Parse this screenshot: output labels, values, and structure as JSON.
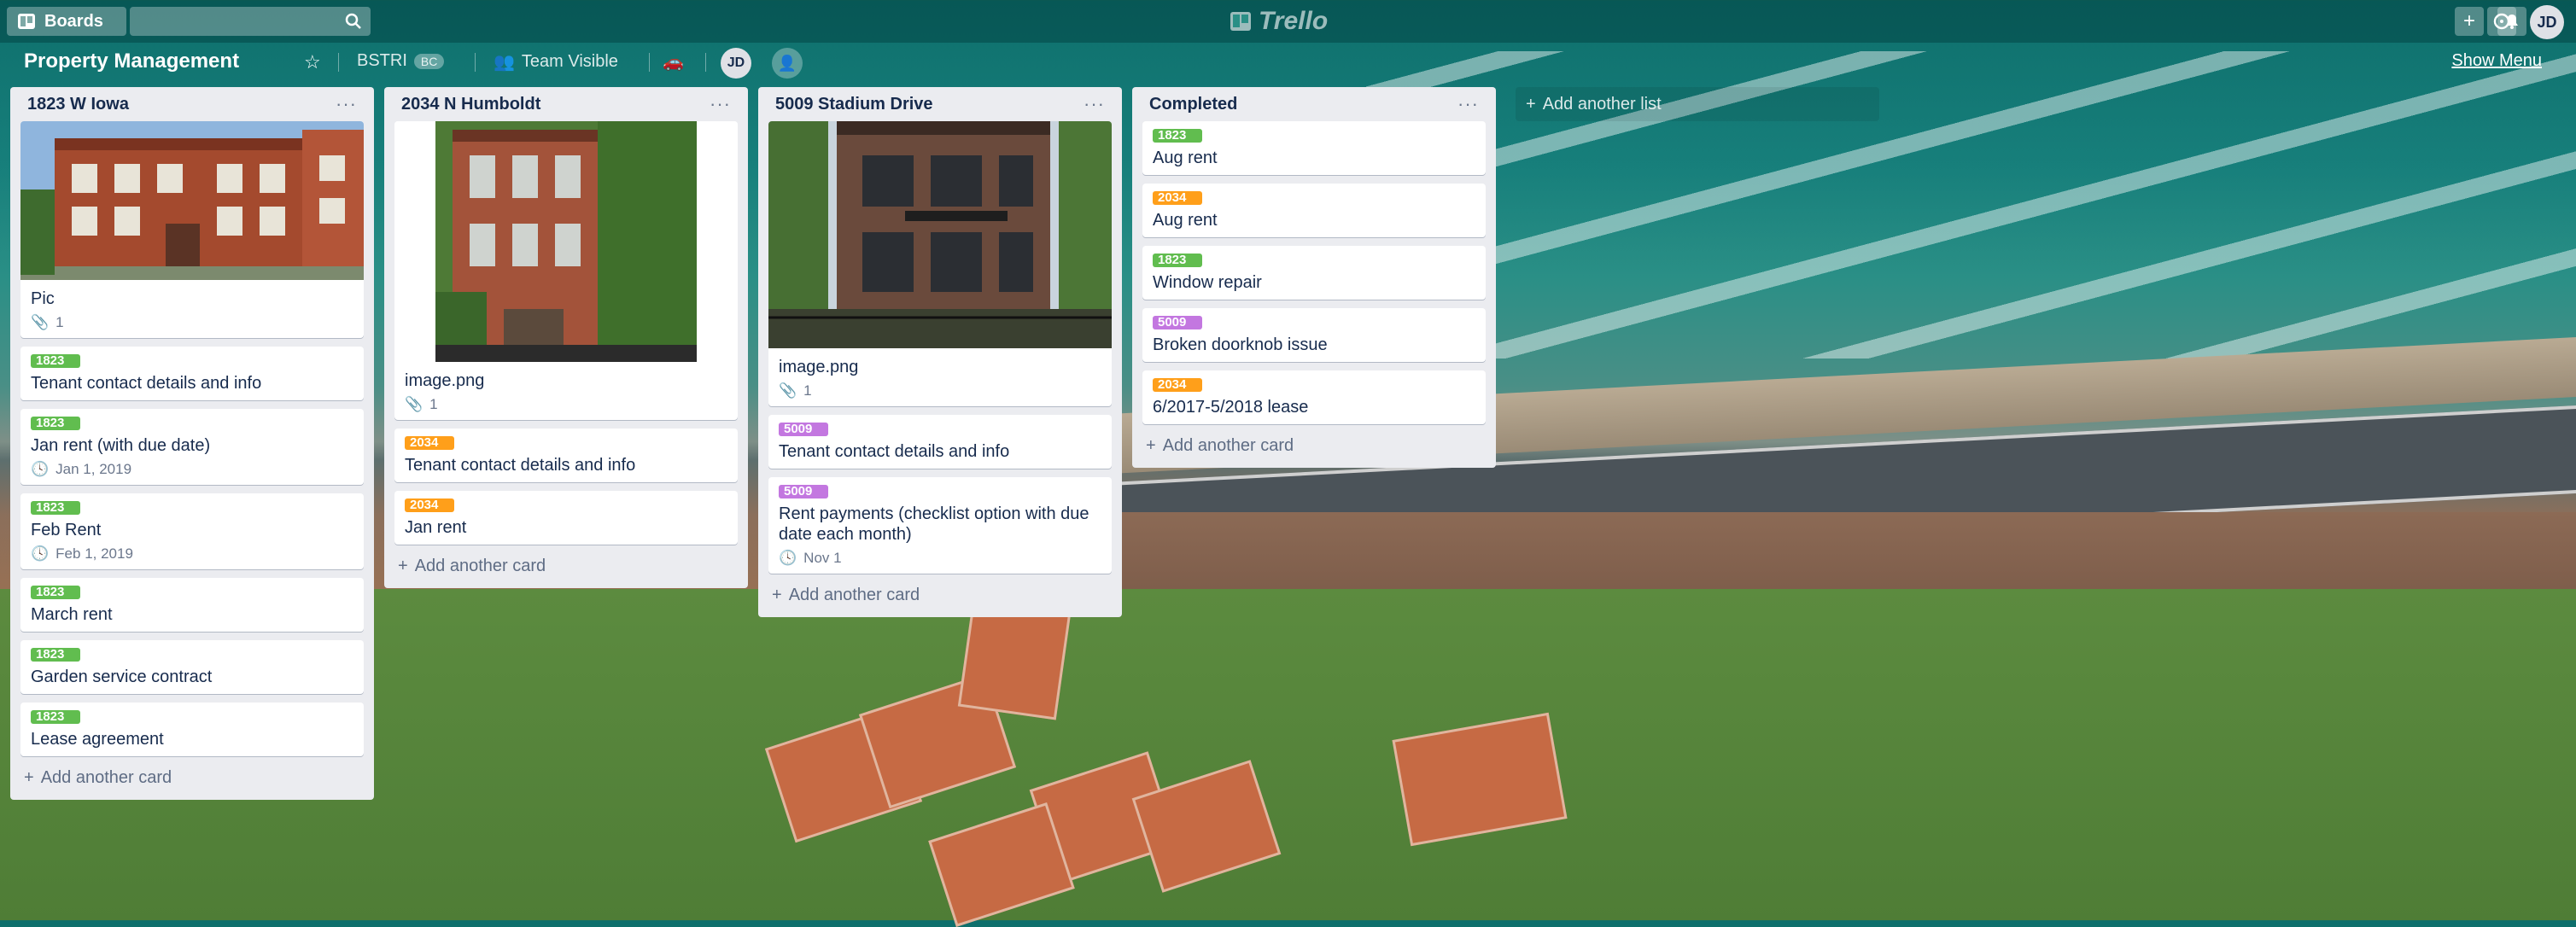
{
  "header": {
    "boards_label": "Boards",
    "logo_text": "Trello",
    "user_initials": "JD"
  },
  "board": {
    "title": "Property Management",
    "team_name": "BSTRI",
    "team_badge": "BC",
    "visibility": "Team Visible",
    "member_initials": "JD",
    "show_menu": "Show Menu"
  },
  "colors": {
    "label_1823": "#61bd4f",
    "label_2034": "#ff9f1a",
    "label_5009": "#c377e0"
  },
  "lists": [
    {
      "title": "1823 W Iowa",
      "cards": [
        {
          "title": "Pic",
          "attachments": "1"
        },
        {
          "label": "1823",
          "title": "Tenant contact details and info"
        },
        {
          "label": "1823",
          "title": "Jan rent (with due date)",
          "due": "Jan 1, 2019"
        },
        {
          "label": "1823",
          "title": "Feb Rent",
          "due": "Feb 1, 2019"
        },
        {
          "label": "1823",
          "title": "March rent"
        },
        {
          "label": "1823",
          "title": "Garden service contract"
        },
        {
          "label": "1823",
          "title": "Lease agreement"
        }
      ],
      "add_card": "Add another card"
    },
    {
      "title": "2034 N Humboldt",
      "cards": [
        {
          "title": "image.png",
          "attachments": "1"
        },
        {
          "label": "2034",
          "title": "Tenant contact details and info"
        },
        {
          "label": "2034",
          "title": "Jan rent"
        }
      ],
      "add_card": "Add another card"
    },
    {
      "title": "5009 Stadium Drive",
      "cards": [
        {
          "title": "image.png",
          "attachments": "1"
        },
        {
          "label": "5009",
          "title": "Tenant contact details and info"
        },
        {
          "label": "5009",
          "title": "Rent payments (checklist option with due date each month)",
          "due": "Nov 1"
        }
      ],
      "add_card": "Add another card"
    },
    {
      "title": "Completed",
      "cards": [
        {
          "label": "1823",
          "title": "Aug rent"
        },
        {
          "label": "2034",
          "title": "Aug rent"
        },
        {
          "label": "1823",
          "title": "Window repair"
        },
        {
          "label": "5009",
          "title": "Broken doorknob issue"
        },
        {
          "label": "2034",
          "title": "6/2017-5/2018 lease"
        }
      ],
      "add_card": "Add another card"
    }
  ],
  "add_list": "Add another list"
}
